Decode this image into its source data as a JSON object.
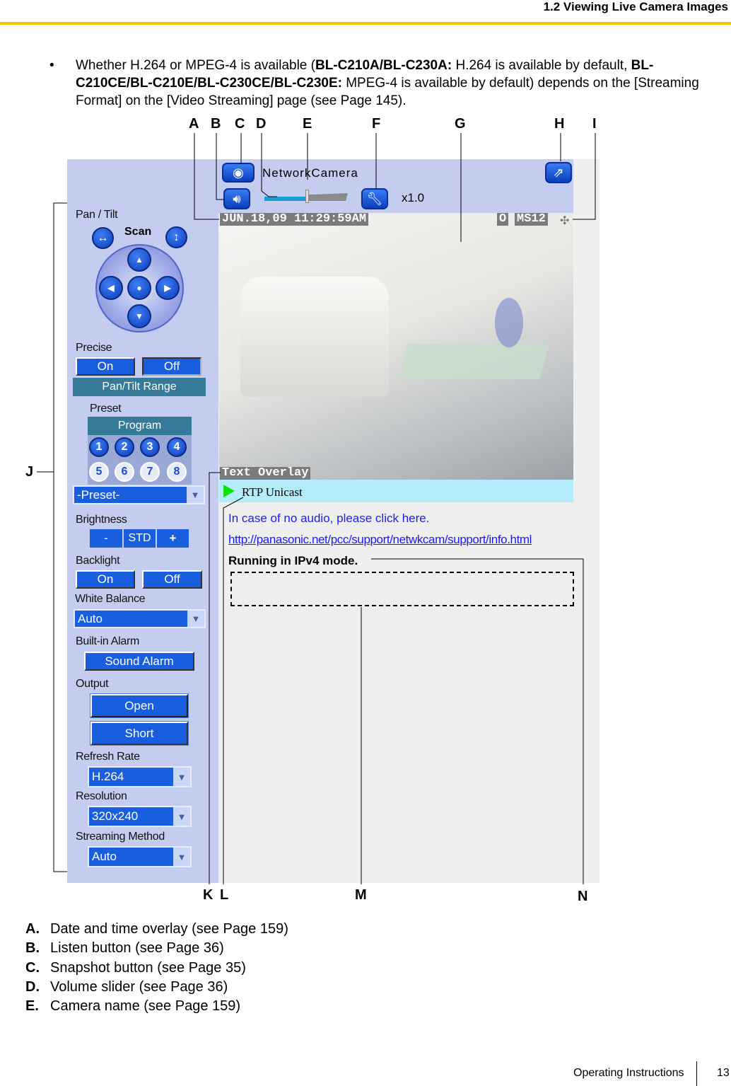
{
  "header": {
    "title": "1.2 Viewing Live Camera Images"
  },
  "bullet": {
    "pre": "Whether H.264 or MPEG-4 is available (",
    "b1": "BL-C210A/BL-C230A:",
    "t1": " H.264 is available by default, ",
    "b2": "BL-C210CE/BL-C210E/BL-C230CE/BL-C230E:",
    "t2": " MPEG-4 is available by default) depends on the [Streaming Format] on the [Video Streaming] page (see Page 145)."
  },
  "callouts": [
    "A",
    "B",
    "C",
    "D",
    "E",
    "F",
    "G",
    "H",
    "I",
    "J",
    "K",
    "L",
    "M",
    "N"
  ],
  "camera": {
    "name": "NetworkCamera",
    "zoom": "x1.0",
    "datetime": "JUN.18,09 11:29:59AM",
    "status_o": "O",
    "status_ms": "MS12",
    "text_overlay": "Text Overlay",
    "stream_mode": "RTP Unicast",
    "volume_percent": 48,
    "audio_link": "In case of no audio, please click here.",
    "support_link": "http://panasonic.net/pcc/support/netwkcam/support/info.html",
    "ip_mode": "Running in IPv4 mode."
  },
  "controls": {
    "pan_tilt": "Pan / Tilt",
    "scan": "Scan",
    "precise": "Precise",
    "on": "On",
    "off": "Off",
    "pan_tilt_range": "Pan/Tilt Range",
    "preset": "Preset",
    "program": "Program",
    "preset_numbers": [
      "1",
      "2",
      "3",
      "4",
      "5",
      "6",
      "7",
      "8"
    ],
    "preset_select": "-Preset-",
    "brightness": "Brightness",
    "minus": "-",
    "std": "STD",
    "plus": "+",
    "backlight": "Backlight",
    "white_balance": "White Balance",
    "white_balance_value": "Auto",
    "alarm": "Built-in Alarm",
    "sound_alarm": "Sound Alarm",
    "output": "Output",
    "open": "Open",
    "short": "Short",
    "refresh_rate": "Refresh Rate",
    "refresh_rate_value": "H.264",
    "resolution": "Resolution",
    "resolution_value": "320x240",
    "streaming_method": "Streaming Method",
    "streaming_method_value": "Auto"
  },
  "legend": [
    {
      "letter": "A.",
      "text": "Date and time overlay (see Page 159)"
    },
    {
      "letter": "B.",
      "text": "Listen button (see Page 36)"
    },
    {
      "letter": "C.",
      "text": "Snapshot button (see Page 35)"
    },
    {
      "letter": "D.",
      "text": "Volume slider (see Page 36)"
    },
    {
      "letter": "E.",
      "text": "Camera name (see Page 159)"
    }
  ],
  "footer": {
    "doc": "Operating Instructions",
    "page": "13"
  },
  "colors": {
    "accent": "#f0c800",
    "panel": "#c4cdef",
    "button": "#1a5ee0",
    "link": "#1a1aff"
  }
}
